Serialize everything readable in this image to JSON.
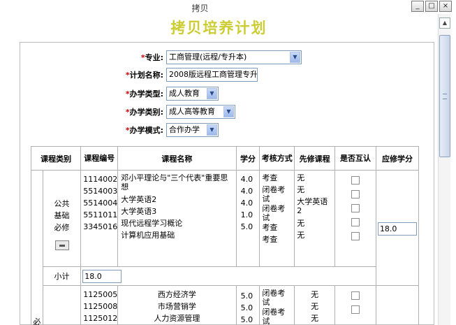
{
  "window": {
    "title": "拷贝",
    "controls": {
      "minimize": "_",
      "maximize": "□",
      "close": "×"
    }
  },
  "page": {
    "title": "拷贝培养计划"
  },
  "form": {
    "major": {
      "label": "专业:",
      "value": "工商管理(远程/专升本)"
    },
    "plan_name": {
      "label": "计划名称:",
      "value": "2008版远程工商管理专升"
    },
    "school_type": {
      "label": "办学类型:",
      "value": "成人教育"
    },
    "school_category": {
      "label": "办学类别:",
      "value": "成人高等教育"
    },
    "school_mode": {
      "label": "办学模式:",
      "value": "合作办学"
    },
    "required_mark": "*"
  },
  "table": {
    "headers": {
      "category": "课程类别",
      "code": "课程编号",
      "name": "课程名称",
      "credit": "学分",
      "exam": "考核方式",
      "prereq": "先修课程",
      "mutual": "是否互认",
      "required_credit": "应修学分"
    },
    "group1": {
      "parent_label": "",
      "label": "公共基础必修",
      "codes": [
        "1114002",
        "5514003",
        "5514004",
        "5511011",
        "3345016"
      ],
      "names": [
        "邓小平理论与\"三个代表\"重要思想",
        "大学英语2",
        "大学英语3",
        "现代远程学习概论",
        "计算机应用基础"
      ],
      "credits": [
        "4.0",
        "4.0",
        "4.0",
        "1.0",
        "5.0"
      ],
      "exams": [
        "考查",
        "闭卷考试",
        "闭卷考试",
        "考查",
        "考查"
      ],
      "prereqs": [
        "无",
        "无",
        "大学英语2",
        "无",
        "无"
      ],
      "required_credit": "18.0",
      "subtotal_label": "小计",
      "subtotal_value": "18.0"
    },
    "group2": {
      "parent_label": "必",
      "codes": [
        "1125005",
        "1125008",
        "1125012"
      ],
      "names": [
        "西方经济学",
        "市场营销学",
        "人力资源管理"
      ],
      "credits": [
        "5.0",
        "5.0",
        "5.0"
      ],
      "exams": [
        "闭卷考试",
        "闭卷考试",
        "闭卷考试"
      ],
      "prereqs": [
        "无",
        "无",
        "无"
      ]
    }
  }
}
